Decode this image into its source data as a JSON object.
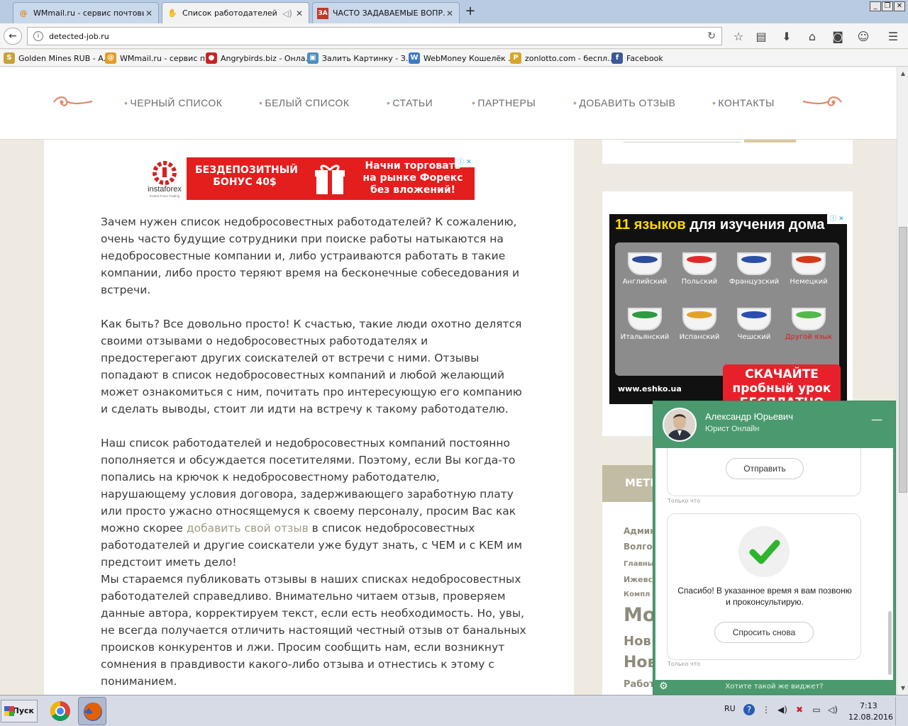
{
  "tabs": [
    {
      "title": "WMmail.ru - сервис почтовы...",
      "active": false,
      "favicon": "at-icon"
    },
    {
      "title": "Список работодателей",
      "active": true,
      "favicon": "hand-icon"
    },
    {
      "title": "ЧАСТО ЗАДАВАЕМЫЕ ВОПР...",
      "active": false,
      "favicon": "za-icon",
      "favicon_text": "ЗА"
    }
  ],
  "address": {
    "url": "detected-job.ru"
  },
  "bookmarks": [
    {
      "label": "Golden Mines RUB - A...",
      "icon": "S",
      "color": "#c8a23a"
    },
    {
      "label": "WMmail.ru - сервис п...",
      "icon": "@",
      "color": "#e69a22"
    },
    {
      "label": "Angrybirds.biz - Онла...",
      "icon": "●",
      "color": "#cc2222"
    },
    {
      "label": "Залить Картинку - З...",
      "icon": "▣",
      "color": "#4a90c0"
    },
    {
      "label": "WebMoney Кошелёк ...",
      "icon": "W",
      "color": "#3d7bc4"
    },
    {
      "label": "zonlotto.com - беспл...",
      "icon": "P",
      "color": "#d8a52a"
    },
    {
      "label": "Facebook",
      "icon": "f",
      "color": "#3b5998"
    }
  ],
  "site_nav": [
    "ЧЕРНЫЙ СПИСОК",
    "БЕЛЫЙ СПИСОК",
    "СТАТЬИ",
    "ПАРТНЕРЫ",
    "ДОБАВИТЬ ОТЗЫВ",
    "КОНТАКТЫ"
  ],
  "ad_top": {
    "brand": "instaforex",
    "brand_sub": "Instant Forex Trading",
    "bonus": "БЕЗДЕПОЗИТНЫЙ БОНУС 40$",
    "cta": "Начни торговать на рынке Форекс без вложений!"
  },
  "paragraphs": [
    {
      "text": "Зачем нужен список недобросовестных работодателей? К сожалению, очень часто будущие сотрудники при поиске работы натыкаются на недобросовестные компании и, либо устраиваются работать в такие компании, либо просто теряют время на бесконечные собеседования и встречи."
    },
    {
      "text": "Как быть? Все довольно просто! К счастью, такие люди охотно делятся своими отзывами о недобросовестных работодателях и предостерегают других соискателей от встречи с ними. Отзывы попадают в список недобросовестных компаний и любой желающий может ознакомиться с ним, почитать про интересующую его компанию и сделать выводы, стоит ли идти на встречу к такому работодателю."
    },
    {
      "text_before": "Наш список работодателей и недобросовестных компаний постоянно пополняется и обсуждается посетителями. Поэтому, если Вы когда-то попались на крючок к недобросовестному работодателю, нарушающему условия договора, задерживающего заработную плату или просто ужасно относящемуся к своему персоналу, просим Вас как можно скорее ",
      "link": "добавить свой отзыв",
      "text_after": " в список недобросовестных работодателей и другие соискатели уже будут знать, с ЧЕМ и с КЕМ им предстоит иметь дело!"
    },
    {
      "text": "Мы стараемся публиковать отзывы в наших списках недобросовестных работодателей справедливо. Внимательно читаем отзыв, проверяем данные автора, корректируем текст, если есть необходимость. Но, увы, не всегда получается отличить настоящий честный отзыв от банальных происков конкурентов и лжи. Просим сообщить нам, если возникнут сомнения в правдивости какого-либо отзыва и отнестись к этому с пониманием."
    }
  ],
  "ad_side": {
    "headline_accent": "11 языков",
    "headline_rest": "для изучения дома",
    "languages": [
      {
        "label": "Английский",
        "flag": "#2b4a9a"
      },
      {
        "label": "Польский",
        "flag": "#e02a2a"
      },
      {
        "label": "Французский",
        "flag": "#2c4fa8"
      },
      {
        "label": "Немецкий",
        "flag": "#d23a1a"
      },
      {
        "label": "Итальянский",
        "flag": "#2e9a44"
      },
      {
        "label": "Испанский",
        "flag": "#e2a22a"
      },
      {
        "label": "Чешский",
        "flag": "#2b4fb0"
      },
      {
        "label": "Другой язык",
        "flag": "#52b84a",
        "highlight": true
      }
    ],
    "url": "www.eshko.ua",
    "cta": "СКАЧАЙТЕ пробный урок БЕСПЛАТНО"
  },
  "sidebar_tags": {
    "header": "МЕТК",
    "items": [
      "Админ",
      "Волго",
      "Главны",
      "Ижевс",
      "Компл",
      "Мо",
      "Нов",
      "Нов",
      "Работ"
    ]
  },
  "chat": {
    "name": "Александр Юрьевич",
    "role": "Юрист Онлайн",
    "send_label": "Отправить",
    "timestamp": "Только что",
    "thanks": "Спасибо! В указанное время я вам позвоню и проконсультирую.",
    "ask_again": "Спросить снова",
    "footer": "Хотите такой же виджет?"
  },
  "taskbar": {
    "start": "Пуск",
    "lang": "RU",
    "time": "7:13",
    "date": "12.08.2016"
  }
}
